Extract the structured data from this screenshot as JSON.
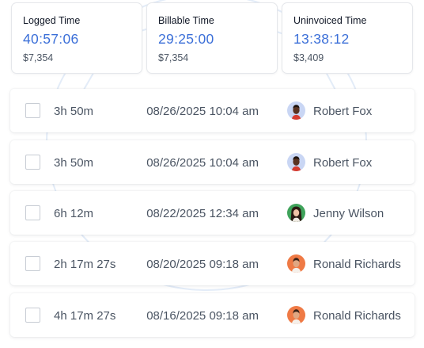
{
  "summary": {
    "cards": [
      {
        "label": "Logged Time",
        "time": "40:57:06",
        "amount": "$7,354"
      },
      {
        "label": "Billable Time",
        "time": "29:25:00",
        "amount": "$7,354"
      },
      {
        "label": "Uninvoiced Time",
        "time": "13:38:12",
        "amount": "$3,409"
      }
    ]
  },
  "entries": [
    {
      "duration": "3h 50m",
      "datetime": "08/26/2025 10:04 am",
      "user": "Robert Fox",
      "avatar": "robert-fox-avatar"
    },
    {
      "duration": "3h 50m",
      "datetime": "08/26/2025 10:04 am",
      "user": "Robert Fox",
      "avatar": "robert-fox-avatar"
    },
    {
      "duration": "6h 12m",
      "datetime": "08/22/2025 12:34 am",
      "user": "Jenny Wilson",
      "avatar": "jenny-wilson-avatar"
    },
    {
      "duration": "2h 17m 27s",
      "datetime": "08/20/2025 09:18 am",
      "user": "Ronald Richards",
      "avatar": "ronald-richards-avatar"
    },
    {
      "duration": "4h 17m 27s",
      "datetime": "08/16/2025 09:18 am",
      "user": "Ronald Richards",
      "avatar": "ronald-richards-avatar"
    }
  ],
  "colors": {
    "time_value": "#3b6fd8",
    "avatar_robert_bg": "#c9d6f4",
    "avatar_jenny_bg": "#3fa35b",
    "avatar_ronald_bg": "#ef7a45"
  }
}
